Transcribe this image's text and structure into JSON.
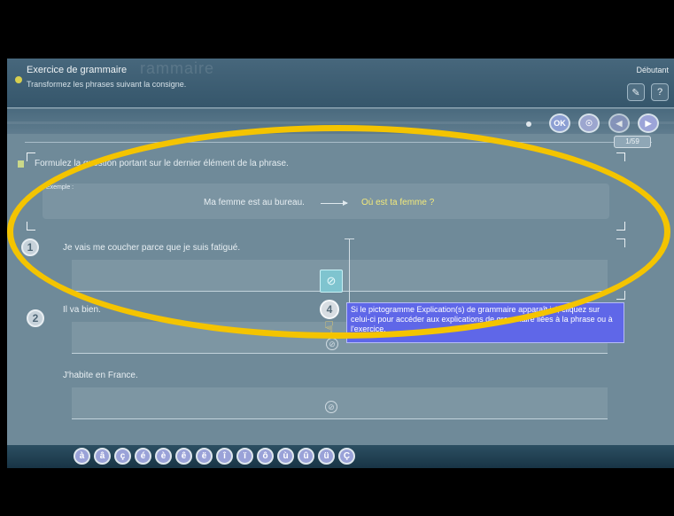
{
  "header": {
    "title": "Exercice de grammaire",
    "title_ghost": "rammaire",
    "subtitle": "Transformez les phrases suivant la consigne.",
    "level": "Débutant"
  },
  "toolbar": {
    "help_icon": "question-icon",
    "settings_icon": "tool-icon"
  },
  "navigation": {
    "ok_label": "OK",
    "counter": "1/59"
  },
  "instruction": "Formulez la question portant sur le dernier élément de la phrase.",
  "example": {
    "label": "Exemple :",
    "source": "Ma femme est au bureau.",
    "target": "Où est ta femme ?"
  },
  "questions": [
    {
      "number": "1",
      "text": "Je vais me coucher parce que je suis fatigué."
    },
    {
      "number": "2",
      "text": "Il va bien."
    },
    {
      "number": "",
      "text": "J'habite en France."
    }
  ],
  "help_callout": {
    "number": "4",
    "text": "Si le pictogramme Explication(s) de grammaire apparaît ici, cliquez sur celui-ci pour accéder aux explications de grammaire liées à la phrase ou à l'exercice."
  },
  "special_characters": [
    "à",
    "â",
    "ç",
    "é",
    "è",
    "ê",
    "ë",
    "î",
    "ï",
    "ô",
    "ù",
    "û",
    "ü",
    "Ç"
  ],
  "colors": {
    "highlight_ellipse": "#f4c400",
    "callout_bg": "#5f67e8",
    "example_target": "#f2e97a"
  }
}
